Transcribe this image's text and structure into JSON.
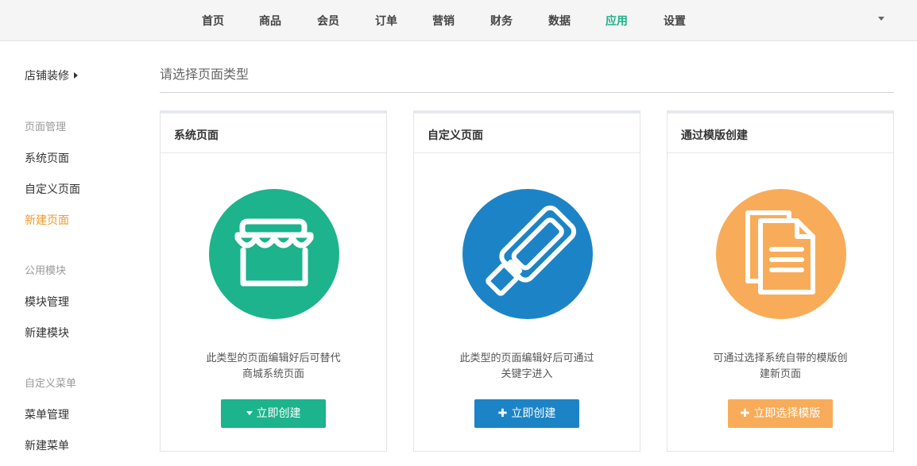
{
  "nav": {
    "items": [
      {
        "label": "首页",
        "name": "nav-home"
      },
      {
        "label": "商品",
        "name": "nav-goods"
      },
      {
        "label": "会员",
        "name": "nav-members"
      },
      {
        "label": "订单",
        "name": "nav-orders"
      },
      {
        "label": "营销",
        "name": "nav-marketing"
      },
      {
        "label": "财务",
        "name": "nav-finance"
      },
      {
        "label": "数据",
        "name": "nav-data"
      },
      {
        "label": "应用",
        "name": "nav-apps",
        "active": true
      },
      {
        "label": "设置",
        "name": "nav-settings"
      }
    ]
  },
  "sidebar": {
    "title": "店铺装修",
    "groups": [
      {
        "label": "页面管理",
        "links": [
          "系统页面",
          "自定义页面",
          "新建页面"
        ]
      },
      {
        "label": "公用模块",
        "links": [
          "模块管理",
          "新建模块"
        ]
      },
      {
        "label": "自定义菜单",
        "links": [
          "菜单管理",
          "新建菜单"
        ]
      }
    ],
    "active_link": "新建页面"
  },
  "main": {
    "heading": "请选择页面类型",
    "cards": [
      {
        "title": "系统页面",
        "icon": "storefront-icon",
        "color": "#1db38c",
        "desc_line1": "此类型的页面编辑好后可替代",
        "desc_line2": "商城系统页面",
        "button_label": "立即创建",
        "button_icon": "caret-down-icon"
      },
      {
        "title": "自定义页面",
        "icon": "paint-roller-icon",
        "color": "#1c84c6",
        "desc_line1": "此类型的页面编辑好后可通过",
        "desc_line2": "关键字进入",
        "button_label": "立即创建",
        "button_icon": "plus-icon"
      },
      {
        "title": "通过模版创建",
        "icon": "documents-icon",
        "color": "#f8ac59",
        "desc_line1": "可通过选择系统自带的模版创",
        "desc_line2": "建新页面",
        "button_label": "立即选择模版",
        "button_icon": "plus-icon"
      }
    ]
  }
}
